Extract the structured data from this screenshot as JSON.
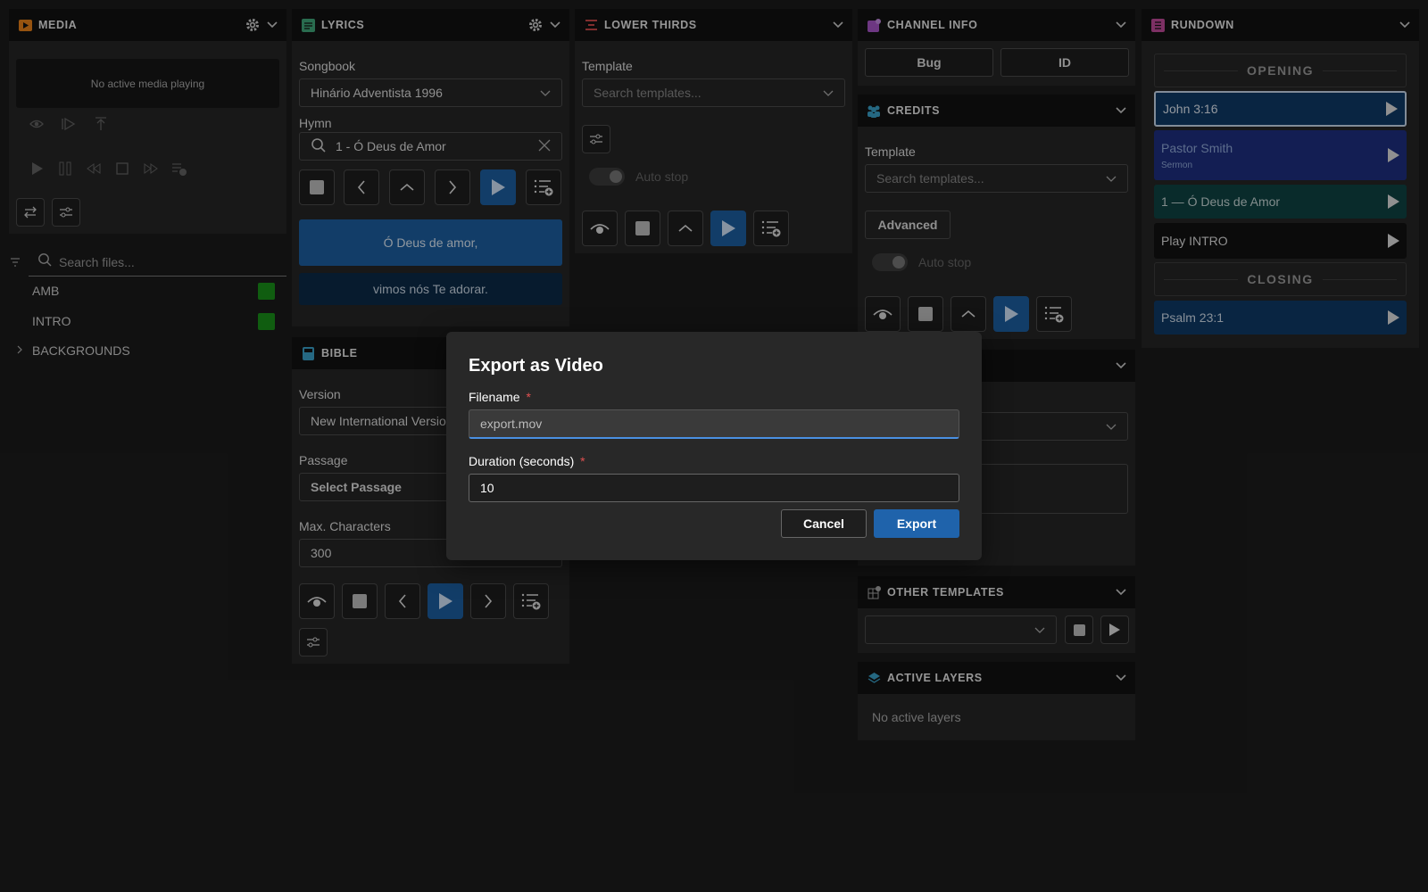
{
  "media": {
    "title": "MEDIA",
    "status": "No active media playing",
    "search_placeholder": "Search files...",
    "files": [
      {
        "name": "AMB",
        "color": "#1a8f1a"
      },
      {
        "name": "INTRO",
        "color": "#1a8f1a"
      }
    ],
    "folder": "BACKGROUNDS"
  },
  "lyrics": {
    "title": "LYRICS",
    "songbook_label": "Songbook",
    "songbook_value": "Hinário Adventista 1996",
    "hymn_label": "Hymn",
    "hymn_value": "1 - Ó Deus de Amor",
    "line_active": "Ó Deus de amor,",
    "line_next": "vimos nós Te adorar."
  },
  "lower_thirds": {
    "title": "LOWER THIRDS",
    "template_label": "Template",
    "template_placeholder": "Search templates...",
    "autostop": "Auto stop"
  },
  "channel_info": {
    "title": "CHANNEL INFO",
    "bug": "Bug",
    "id": "ID"
  },
  "credits": {
    "title": "CREDITS",
    "template_label": "Template",
    "template_placeholder": "Search templates...",
    "advanced": "Advanced",
    "autostop": "Auto stop"
  },
  "other_templates": {
    "title": "OTHER TEMPLATES"
  },
  "active_layers": {
    "title": "ACTIVE LAYERS",
    "empty": "No active layers"
  },
  "bible": {
    "title": "BIBLE",
    "version_label": "Version",
    "version_value": "New International Versio",
    "passage_label": "Passage",
    "passage_value": "Select Passage",
    "maxchars_label": "Max. Characters",
    "maxchars_value": "300"
  },
  "rundown": {
    "title": "RUNDOWN",
    "section_opening": "OPENING",
    "section_closing": "CLOSING",
    "items": [
      {
        "title": "John 3:16",
        "sub": "",
        "bg": "#0e3a66"
      },
      {
        "title": "Pastor Smith",
        "sub": "Sermon",
        "bg": "#1e2f80"
      },
      {
        "title": "1 — Ó Deus de Amor",
        "sub": "",
        "bg": "#0e4242"
      },
      {
        "title": "Play INTRO",
        "sub": "",
        "bg": "#121212"
      },
      {
        "title": "Psalm 23:1",
        "sub": "",
        "bg": "#0e3a66"
      }
    ]
  },
  "dialog": {
    "title": "Export as Video",
    "filename_label": "Filename",
    "filename_value": "export.mov",
    "duration_label": "Duration (seconds)",
    "duration_value": "10",
    "required_mark": "*",
    "cancel": "Cancel",
    "export": "Export"
  },
  "colors": {
    "accent": "#1d5fa0",
    "media_icon": "#e6801a",
    "lyrics_icon": "#3fa77a",
    "lower_icon": "#e05050",
    "channel_icon": "#a855c8",
    "credits_icon": "#3aa0c8",
    "rundown_icon": "#c04a9a"
  }
}
